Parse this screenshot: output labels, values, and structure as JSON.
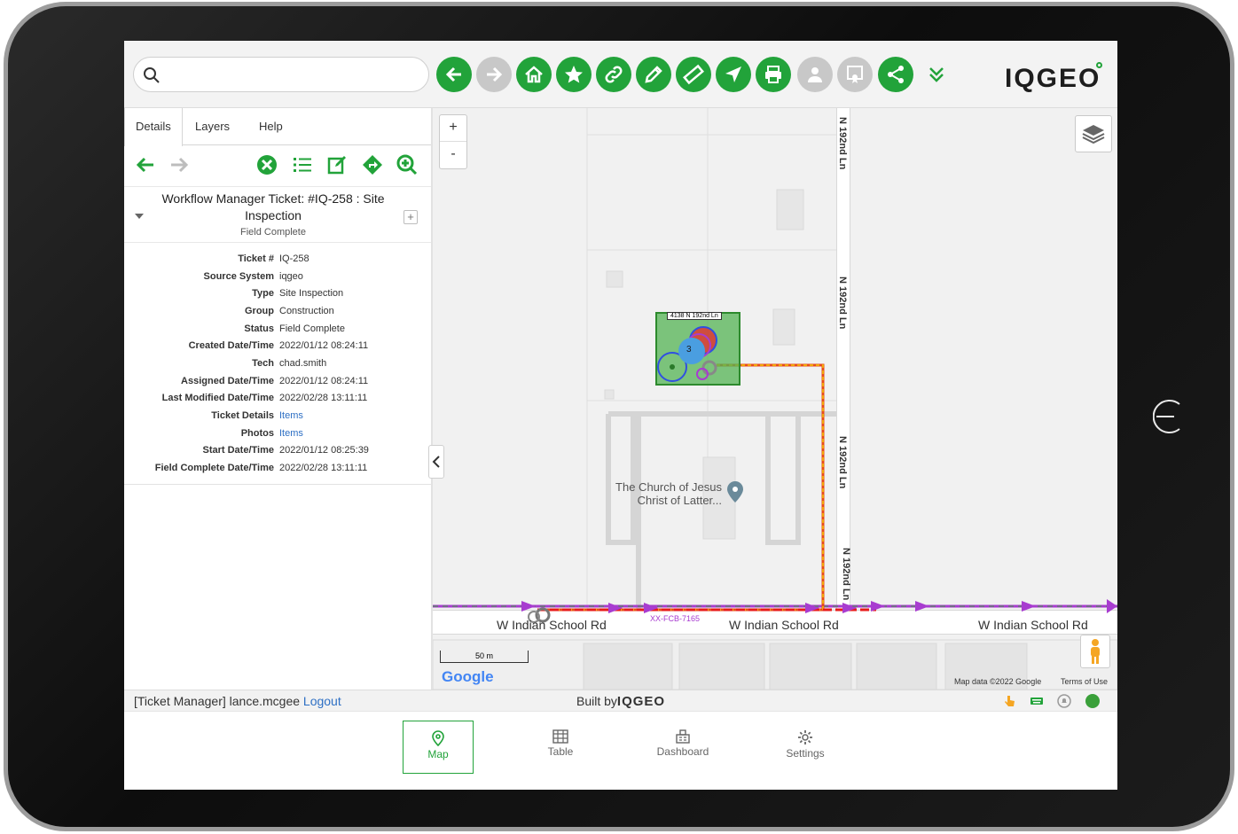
{
  "search": {
    "placeholder": ""
  },
  "toolbar": {
    "buttons": [
      "back-icon",
      "forward-icon",
      "home-icon",
      "star-icon",
      "link-icon",
      "pencil-icon",
      "ruler-icon",
      "navigate-icon",
      "print-icon",
      "user-icon",
      "certificate-icon",
      "share-icon"
    ],
    "accent": "#22a33a",
    "logo": "IQGEO"
  },
  "panel": {
    "tabs": [
      "Details",
      "Layers",
      "Help"
    ],
    "feature_title": "Workflow Manager Ticket: #IQ-258 : Site Inspection",
    "feature_status": "Field Complete",
    "details": [
      {
        "label": "Ticket #",
        "value": "IQ-258"
      },
      {
        "label": "Source System",
        "value": "iqgeo"
      },
      {
        "label": "Type",
        "value": "Site Inspection"
      },
      {
        "label": "Group",
        "value": "Construction"
      },
      {
        "label": "Status",
        "value": "Field Complete"
      },
      {
        "label": "Created Date/Time",
        "value": "2022/01/12 08:24:11"
      },
      {
        "label": "Tech",
        "value": "chad.smith"
      },
      {
        "label": "Assigned Date/Time",
        "value": "2022/01/12 08:24:11"
      },
      {
        "label": "Last Modified Date/Time",
        "value": "2022/02/28 13:11:11"
      },
      {
        "label": "Ticket Details",
        "value": "Items"
      },
      {
        "label": "Photos",
        "value": "Items"
      },
      {
        "label": "Start Date/Time",
        "value": "2022/01/12 08:25:39"
      },
      {
        "label": "Field Complete Date/Time",
        "value": "2022/02/28 13:11:11"
      }
    ]
  },
  "map": {
    "zoom_in": "+",
    "zoom_out": "-",
    "road_v": "N 192nd Ln",
    "road_h": "W Indian School Rd",
    "poi": "The Church of Jesus Christ of Latter...",
    "address_label": "4138 N 192nd Ln",
    "cluster_count": "3",
    "cable_label": "XX-FCB-7165",
    "scale": "50 m",
    "google": "Google",
    "map_data": "Map data ©2022 Google",
    "terms": "Terms of Use"
  },
  "status": {
    "user": "[Ticket Manager] lance.mcgee",
    "logout": "Logout",
    "built_by": "Built by",
    "built_logo": "IQGEO"
  },
  "nav": [
    {
      "label": "Map",
      "icon": "map-pin-icon"
    },
    {
      "label": "Table",
      "icon": "table-icon"
    },
    {
      "label": "Dashboard",
      "icon": "dashboard-icon"
    },
    {
      "label": "Settings",
      "icon": "gear-icon"
    }
  ]
}
